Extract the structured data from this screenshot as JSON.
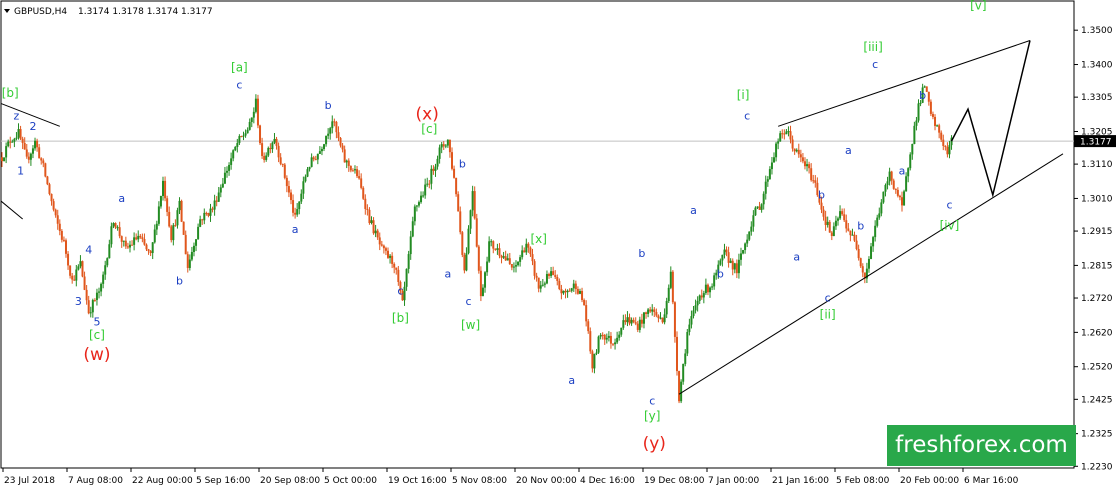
{
  "header": {
    "symbol_label": "GBPUSD,H4",
    "ohlc": "1.3174 1.3178 1.3174 1.3177"
  },
  "chart_data": {
    "type": "candlestick",
    "symbol": "GBPUSD",
    "timeframe": "H4",
    "ohlc": {
      "open": 1.3174,
      "high": 1.3178,
      "low": 1.3174,
      "close": 1.3177
    },
    "current_price": 1.3177,
    "current_price_label": "1.3177",
    "ylim": [
      1.2225,
      1.3585
    ],
    "y_ticks": [
      "1.3500",
      "1.3400",
      "1.3305",
      "1.3205",
      "1.3110",
      "1.3010",
      "1.2915",
      "1.2815",
      "1.2720",
      "1.2620",
      "1.2520",
      "1.2425",
      "1.2325",
      "1.2230"
    ],
    "x_ticks": [
      "23 Jul 2018",
      "7 Aug 08:00",
      "22 Aug 00:00",
      "5 Sep 16:00",
      "20 Sep 08:00",
      "5 Oct 00:00",
      "19 Oct 16:00",
      "5 Nov 08:00",
      "20 Nov 00:00",
      "4 Dec 16:00",
      "19 Dec 08:00",
      "7 Jan 00:00",
      "21 Jan 16:00",
      "5 Feb 08:00",
      "20 Feb 00:00",
      "6 Mar 16:00"
    ],
    "grid": false,
    "price_path": [
      {
        "t": 0,
        "p": 1.313
      },
      {
        "t": 2,
        "p": 1.318
      },
      {
        "t": 4,
        "p": 1.32
      },
      {
        "t": 6,
        "p": 1.312
      },
      {
        "t": 8,
        "p": 1.3175
      },
      {
        "t": 10,
        "p": 1.31
      },
      {
        "t": 13,
        "p": 1.295
      },
      {
        "t": 15,
        "p": 1.288
      },
      {
        "t": 17,
        "p": 1.277
      },
      {
        "t": 19,
        "p": 1.282
      },
      {
        "t": 21,
        "p": 1.268
      },
      {
        "t": 24,
        "p": 1.275
      },
      {
        "t": 27,
        "p": 1.295
      },
      {
        "t": 30,
        "p": 1.286
      },
      {
        "t": 33,
        "p": 1.29
      },
      {
        "t": 36,
        "p": 1.284
      },
      {
        "t": 39,
        "p": 1.306
      },
      {
        "t": 41,
        "p": 1.29
      },
      {
        "t": 43,
        "p": 1.299
      },
      {
        "t": 45,
        "p": 1.281
      },
      {
        "t": 48,
        "p": 1.295
      },
      {
        "t": 51,
        "p": 1.298
      },
      {
        "t": 54,
        "p": 1.308
      },
      {
        "t": 57,
        "p": 1.317
      },
      {
        "t": 60,
        "p": 1.322
      },
      {
        "t": 61.5,
        "p": 1.329
      },
      {
        "t": 63,
        "p": 1.312
      },
      {
        "t": 66,
        "p": 1.319
      },
      {
        "t": 69,
        "p": 1.305
      },
      {
        "t": 71,
        "p": 1.295
      },
      {
        "t": 74,
        "p": 1.31
      },
      {
        "t": 77,
        "p": 1.315
      },
      {
        "t": 80,
        "p": 1.324
      },
      {
        "t": 83,
        "p": 1.312
      },
      {
        "t": 86,
        "p": 1.308
      },
      {
        "t": 89,
        "p": 1.295
      },
      {
        "t": 92,
        "p": 1.286
      },
      {
        "t": 95,
        "p": 1.282
      },
      {
        "t": 97,
        "p": 1.27
      },
      {
        "t": 100,
        "p": 1.298
      },
      {
        "t": 103,
        "p": 1.305
      },
      {
        "t": 106,
        "p": 1.315
      },
      {
        "t": 108,
        "p": 1.318
      },
      {
        "t": 110,
        "p": 1.303
      },
      {
        "t": 112,
        "p": 1.28
      },
      {
        "t": 114,
        "p": 1.304
      },
      {
        "t": 116,
        "p": 1.272
      },
      {
        "t": 118,
        "p": 1.288
      },
      {
        "t": 121,
        "p": 1.285
      },
      {
        "t": 124,
        "p": 1.28
      },
      {
        "t": 127,
        "p": 1.288
      },
      {
        "t": 130,
        "p": 1.275
      },
      {
        "t": 133,
        "p": 1.279
      },
      {
        "t": 136,
        "p": 1.273
      },
      {
        "t": 139,
        "p": 1.276
      },
      {
        "t": 141,
        "p": 1.27
      },
      {
        "t": 143,
        "p": 1.252
      },
      {
        "t": 145,
        "p": 1.262
      },
      {
        "t": 148,
        "p": 1.259
      },
      {
        "t": 151,
        "p": 1.266
      },
      {
        "t": 154,
        "p": 1.264
      },
      {
        "t": 157,
        "p": 1.269
      },
      {
        "t": 160,
        "p": 1.265
      },
      {
        "t": 162,
        "p": 1.279
      },
      {
        "t": 164,
        "p": 1.243
      },
      {
        "t": 166,
        "p": 1.262
      },
      {
        "t": 169,
        "p": 1.273
      },
      {
        "t": 172,
        "p": 1.276
      },
      {
        "t": 175,
        "p": 1.285
      },
      {
        "t": 178,
        "p": 1.28
      },
      {
        "t": 180,
        "p": 1.288
      },
      {
        "t": 182,
        "p": 1.296
      },
      {
        "t": 184,
        "p": 1.3
      },
      {
        "t": 186,
        "p": 1.31
      },
      {
        "t": 188,
        "p": 1.318
      },
      {
        "t": 190,
        "p": 1.321
      },
      {
        "t": 192,
        "p": 1.315
      },
      {
        "t": 195,
        "p": 1.31
      },
      {
        "t": 197,
        "p": 1.305
      },
      {
        "t": 199,
        "p": 1.296
      },
      {
        "t": 201,
        "p": 1.29
      },
      {
        "t": 203,
        "p": 1.297
      },
      {
        "t": 205,
        "p": 1.292
      },
      {
        "t": 207,
        "p": 1.287
      },
      {
        "t": 209,
        "p": 1.278
      },
      {
        "t": 211,
        "p": 1.29
      },
      {
        "t": 213,
        "p": 1.3
      },
      {
        "t": 215,
        "p": 1.308
      },
      {
        "t": 217,
        "p": 1.302
      },
      {
        "t": 218,
        "p": 1.298
      },
      {
        "t": 220,
        "p": 1.315
      },
      {
        "t": 222,
        "p": 1.328
      },
      {
        "t": 223.5,
        "p": 1.334
      },
      {
        "t": 225,
        "p": 1.325
      },
      {
        "t": 227,
        "p": 1.32
      },
      {
        "t": 229,
        "p": 1.314
      },
      {
        "t": 230,
        "p": 1.3177
      }
    ],
    "trend_lines": [
      {
        "name": "upper-channel",
        "t1": 188,
        "p1": 1.322,
        "t2": 249,
        "p2": 1.347
      },
      {
        "name": "lower-channel",
        "t1": 164,
        "p1": 1.244,
        "t2": 257,
        "p2": 1.314
      },
      {
        "name": "left-upper",
        "t1": -1,
        "p1": 1.329,
        "t2": 14,
        "p2": 1.322
      },
      {
        "name": "left-lower",
        "t1": -1,
        "p1": 1.301,
        "t2": 5,
        "p2": 1.295
      }
    ],
    "forecast_path": [
      {
        "t": 230,
        "p": 1.3177
      },
      {
        "t": 234,
        "p": 1.327
      },
      {
        "t": 240,
        "p": 1.302
      },
      {
        "t": 249,
        "p": 1.347
      }
    ],
    "wave_labels": [
      {
        "text": "[b]",
        "t": 2,
        "p": 1.3305,
        "color": "#33cc33",
        "size": 12
      },
      {
        "text": "z",
        "t": 3.5,
        "p": 1.324,
        "color": "#1a3ec2",
        "size": 11
      },
      {
        "text": "2",
        "t": 7.5,
        "p": 1.321,
        "color": "#1a3ec2",
        "size": 11
      },
      {
        "text": "1",
        "t": 4.5,
        "p": 1.308,
        "color": "#1a3ec2",
        "size": 11
      },
      {
        "text": "4",
        "t": 21,
        "p": 1.285,
        "color": "#1a3ec2",
        "size": 11
      },
      {
        "text": "3",
        "t": 18.5,
        "p": 1.27,
        "color": "#1a3ec2",
        "size": 11
      },
      {
        "text": "5",
        "t": 23,
        "p": 1.264,
        "color": "#1a3ec2",
        "size": 11
      },
      {
        "text": "[c]",
        "t": 23,
        "p": 1.26,
        "color": "#33cc33",
        "size": 12
      },
      {
        "text": "(w)",
        "t": 23,
        "p": 1.254,
        "color": "#e8251a",
        "size": 17
      },
      {
        "text": "a",
        "t": 29,
        "p": 1.3,
        "color": "#1a3ec2",
        "size": 11
      },
      {
        "text": "b",
        "t": 43,
        "p": 1.276,
        "color": "#1a3ec2",
        "size": 11
      },
      {
        "text": "[a]",
        "t": 57.5,
        "p": 1.338,
        "color": "#33cc33",
        "size": 12
      },
      {
        "text": "c",
        "t": 57.5,
        "p": 1.333,
        "color": "#1a3ec2",
        "size": 11
      },
      {
        "text": "a",
        "t": 71,
        "p": 1.291,
        "color": "#1a3ec2",
        "size": 11
      },
      {
        "text": "b",
        "t": 79,
        "p": 1.327,
        "color": "#1a3ec2",
        "size": 11
      },
      {
        "text": "c",
        "t": 96.5,
        "p": 1.273,
        "color": "#1a3ec2",
        "size": 11
      },
      {
        "text": "[b]",
        "t": 96.5,
        "p": 1.265,
        "color": "#33cc33",
        "size": 12
      },
      {
        "text": "(x)",
        "t": 103,
        "p": 1.324,
        "color": "#e8251a",
        "size": 17
      },
      {
        "text": "[c]",
        "t": 103.5,
        "p": 1.32,
        "color": "#33cc33",
        "size": 12
      },
      {
        "text": "b",
        "t": 111.5,
        "p": 1.31,
        "color": "#1a3ec2",
        "size": 11
      },
      {
        "text": "a",
        "t": 108,
        "p": 1.278,
        "color": "#1a3ec2",
        "size": 11
      },
      {
        "text": "c",
        "t": 113,
        "p": 1.27,
        "color": "#1a3ec2",
        "size": 11
      },
      {
        "text": "[w]",
        "t": 113.5,
        "p": 1.263,
        "color": "#33cc33",
        "size": 12
      },
      {
        "text": "[x]",
        "t": 130,
        "p": 1.288,
        "color": "#33cc33",
        "size": 12
      },
      {
        "text": "a",
        "t": 138,
        "p": 1.247,
        "color": "#1a3ec2",
        "size": 11
      },
      {
        "text": "b",
        "t": 155,
        "p": 1.284,
        "color": "#1a3ec2",
        "size": 11
      },
      {
        "text": "c",
        "t": 157.5,
        "p": 1.241,
        "color": "#1a3ec2",
        "size": 11
      },
      {
        "text": "[y]",
        "t": 157.5,
        "p": 1.2365,
        "color": "#33cc33",
        "size": 12
      },
      {
        "text": "(y)",
        "t": 158,
        "p": 1.228,
        "color": "#e8251a",
        "size": 17
      },
      {
        "text": "a",
        "t": 167.5,
        "p": 1.2965,
        "color": "#1a3ec2",
        "size": 11
      },
      {
        "text": "b",
        "t": 174,
        "p": 1.278,
        "color": "#1a3ec2",
        "size": 11
      },
      {
        "text": "[i]",
        "t": 179.5,
        "p": 1.33,
        "color": "#33cc33",
        "size": 12
      },
      {
        "text": "c",
        "t": 180.5,
        "p": 1.324,
        "color": "#1a3ec2",
        "size": 11
      },
      {
        "text": "a",
        "t": 192.5,
        "p": 1.283,
        "color": "#1a3ec2",
        "size": 11
      },
      {
        "text": "b",
        "t": 198.5,
        "p": 1.301,
        "color": "#1a3ec2",
        "size": 11
      },
      {
        "text": "c",
        "t": 200,
        "p": 1.271,
        "color": "#1a3ec2",
        "size": 11
      },
      {
        "text": "[ii]",
        "t": 200,
        "p": 1.266,
        "color": "#33cc33",
        "size": 12
      },
      {
        "text": "a",
        "t": 205,
        "p": 1.314,
        "color": "#1a3ec2",
        "size": 11
      },
      {
        "text": "b",
        "t": 208,
        "p": 1.292,
        "color": "#1a3ec2",
        "size": 11
      },
      {
        "text": "[iii]",
        "t": 211,
        "p": 1.344,
        "color": "#33cc33",
        "size": 12
      },
      {
        "text": "c",
        "t": 211.5,
        "p": 1.339,
        "color": "#1a3ec2",
        "size": 11
      },
      {
        "text": "a",
        "t": 218,
        "p": 1.308,
        "color": "#1a3ec2",
        "size": 11
      },
      {
        "text": "b",
        "t": 223,
        "p": 1.33,
        "color": "#1a3ec2",
        "size": 11
      },
      {
        "text": "c",
        "t": 229.5,
        "p": 1.298,
        "color": "#1a3ec2",
        "size": 11
      },
      {
        "text": "[iv]",
        "t": 229.5,
        "p": 1.292,
        "color": "#33cc33",
        "size": 12
      },
      {
        "text": "[v]",
        "t": 236.5,
        "p": 1.356,
        "color": "#33cc33",
        "size": 12
      }
    ],
    "colors": {
      "bull": "#228b22",
      "bear": "#e0561c",
      "lines": "#000000",
      "price_line": "#c0c0c0",
      "price_tag": "#000000"
    }
  },
  "watermark": {
    "text": "freshforex.com",
    "color": "#29a84a"
  }
}
